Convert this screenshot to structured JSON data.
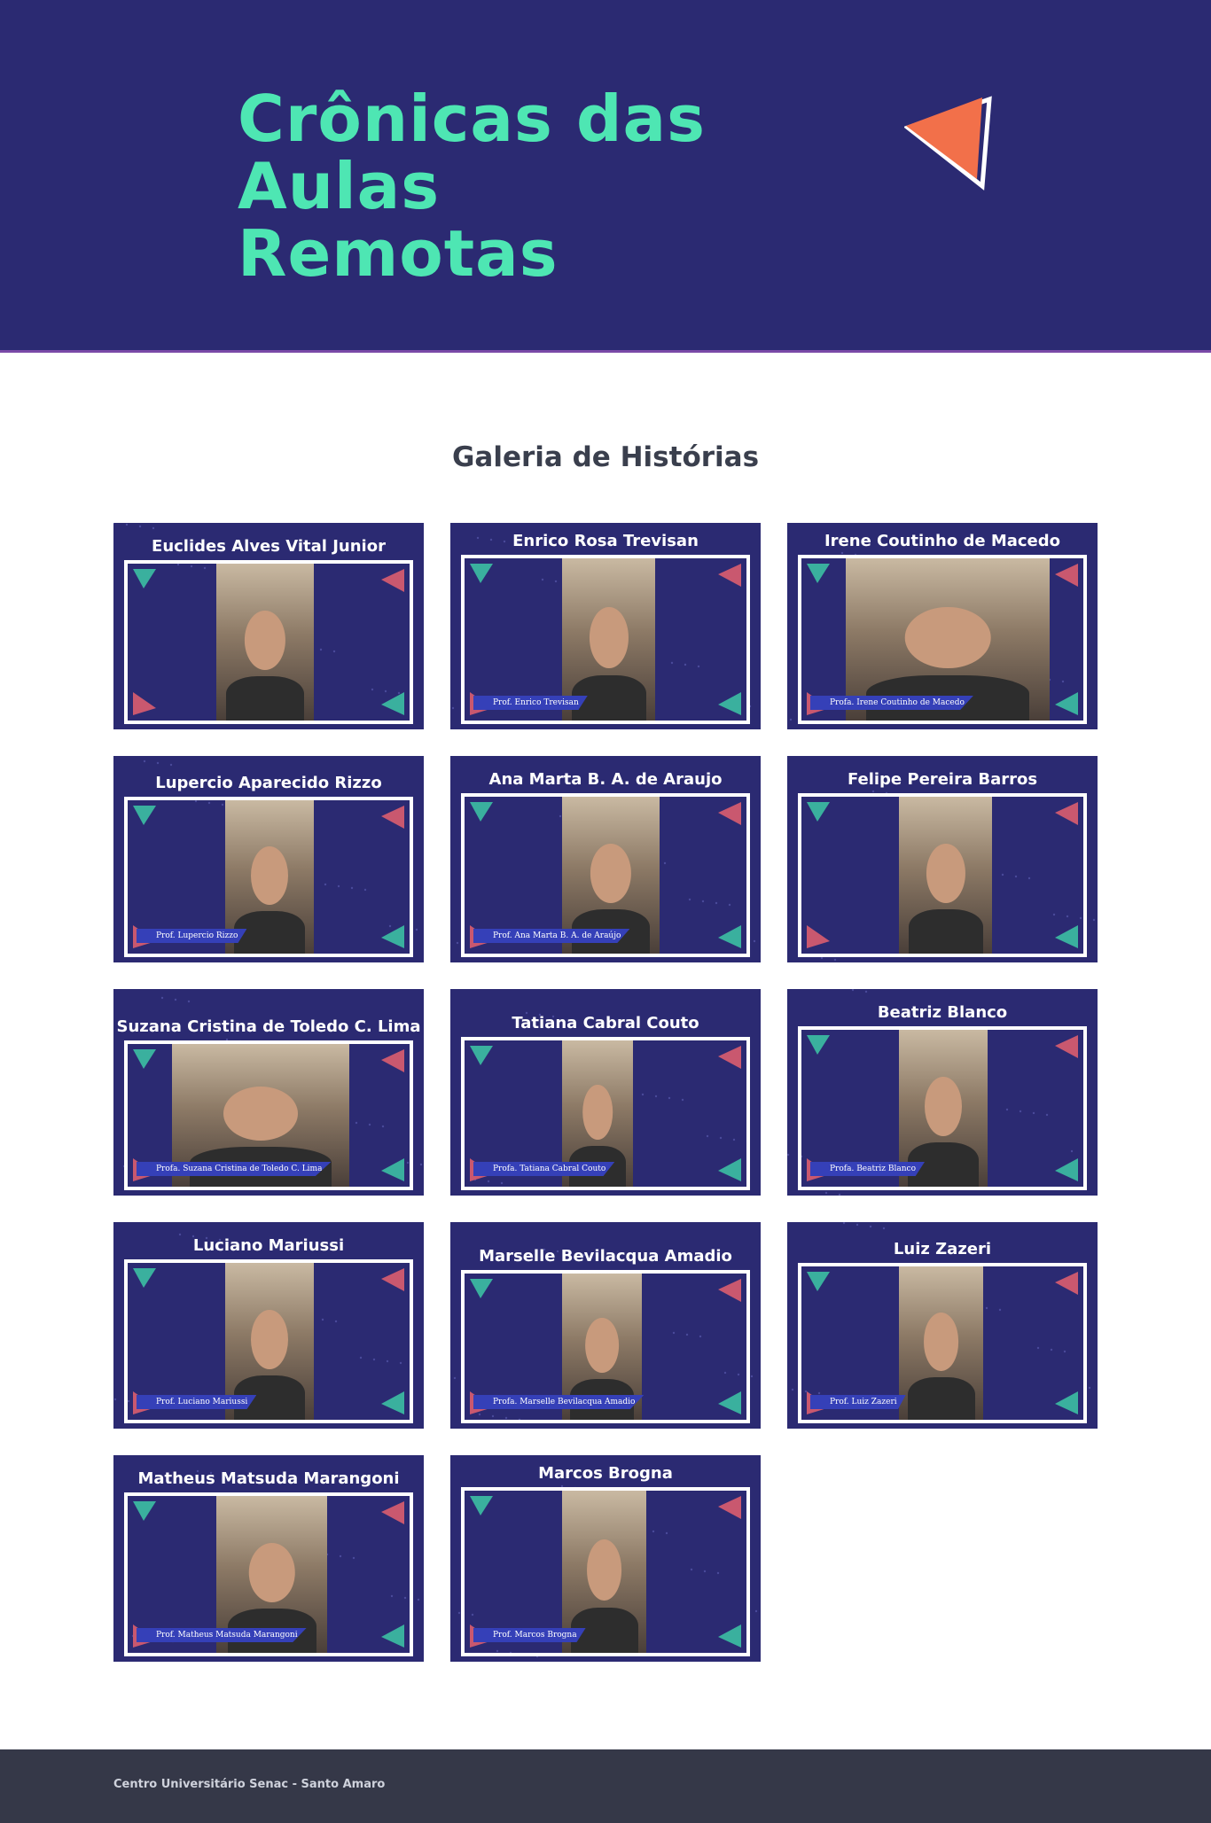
{
  "header": {
    "title_line1": "Crônicas das Aulas",
    "title_line2": "Remotas",
    "accent_color": "#4ee6b3",
    "background_color": "#2b2a72",
    "logo_icon": "triangle-logo-icon"
  },
  "gallery": {
    "title": "Galeria de Histórias",
    "cards": [
      {
        "name": "Euclides Alves Vital Junior",
        "tag": ""
      },
      {
        "name": "Enrico Rosa Trevisan",
        "tag": "Prof. Enrico Trevisan"
      },
      {
        "name": "Irene Coutinho de Macedo",
        "tag": "Profa. Irene Coutinho de Macedo"
      },
      {
        "name": "Lupercio Aparecido Rizzo",
        "tag": "Prof. Lupercio Rizzo"
      },
      {
        "name": "Ana Marta B. A. de Araujo",
        "tag": "Prof. Ana Marta B. A. de Araújo"
      },
      {
        "name": "Felipe Pereira Barros",
        "tag": ""
      },
      {
        "name": "Suzana Cristina de Toledo C. Lima",
        "tag": "Profa. Suzana Cristina de Toledo C. Lima"
      },
      {
        "name": "Tatiana Cabral Couto",
        "tag": "Profa. Tatiana Cabral Couto"
      },
      {
        "name": "Beatriz Blanco",
        "tag": "Profa. Beatriz Blanco"
      },
      {
        "name": "Luciano Mariussi",
        "tag": "Prof. Luciano Mariussi"
      },
      {
        "name": "Marselle Bevilacqua Amadio",
        "tag": "Profa. Marselle Bevilacqua Amadio"
      },
      {
        "name": "Luiz Zazeri",
        "tag": "Prof. Luiz Zazeri"
      },
      {
        "name": "Matheus Matsuda Marangoni",
        "tag": "Prof. Matheus Matsuda Marangoni"
      },
      {
        "name": "Marcos Brogna",
        "tag": "Prof. Marcos Brogna"
      }
    ]
  },
  "footer": {
    "text": "Centro Universitário Senac - Santo Amaro"
  }
}
